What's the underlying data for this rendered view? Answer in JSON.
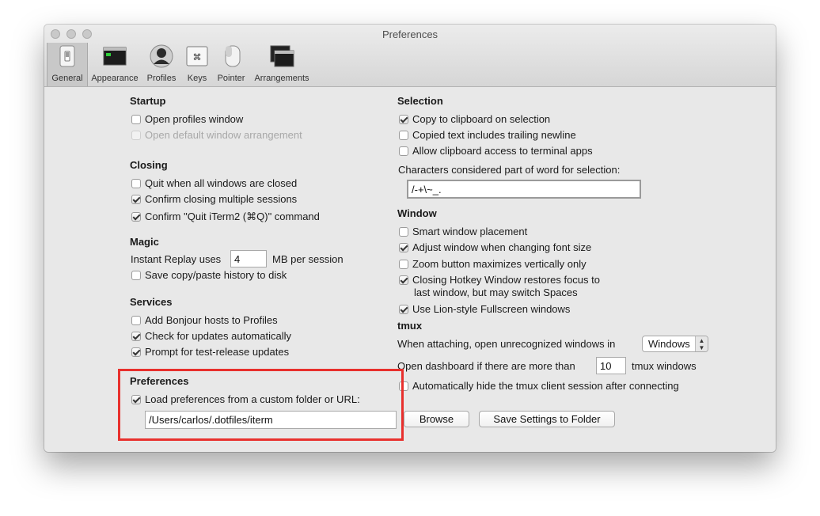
{
  "window": {
    "title": "Preferences"
  },
  "toolbar": {
    "tabs": [
      {
        "label": "General",
        "icon": "switch-icon"
      },
      {
        "label": "Appearance",
        "icon": "monitor-icon"
      },
      {
        "label": "Profiles",
        "icon": "user-icon"
      },
      {
        "label": "Keys",
        "icon": "command-key-icon"
      },
      {
        "label": "Pointer",
        "icon": "mouse-icon"
      },
      {
        "label": "Arrangements",
        "icon": "windows-stack-icon"
      }
    ]
  },
  "startup": {
    "heading": "Startup",
    "open_profiles": "Open profiles window",
    "open_default_arrangement": "Open default window arrangement"
  },
  "closing": {
    "heading": "Closing",
    "quit_when_closed": "Quit when all windows are closed",
    "confirm_multiple": "Confirm closing multiple sessions",
    "confirm_quit": "Confirm \"Quit iTerm2 (⌘Q)\" command"
  },
  "magic": {
    "heading": "Magic",
    "instant_replay_label": "Instant Replay uses",
    "instant_replay_value": "4",
    "instant_replay_unit": "MB per session",
    "save_history": "Save copy/paste history to disk"
  },
  "services": {
    "heading": "Services",
    "bonjour": "Add Bonjour hosts to Profiles",
    "check_updates": "Check for updates automatically",
    "prompt_test_release": "Prompt for test-release updates"
  },
  "preferences": {
    "heading": "Preferences",
    "load_custom": "Load preferences from a custom folder or URL:",
    "path_value": "/Users/carlos/.dotfiles/iterm",
    "browse_label": "Browse",
    "save_settings_label": "Save Settings to Folder"
  },
  "selection": {
    "heading": "Selection",
    "copy_on_selection": "Copy to clipboard on selection",
    "trailing_newline": "Copied text includes trailing newline",
    "clipboard_access": "Allow clipboard access to terminal apps",
    "word_chars_label": "Characters considered part of word for selection:",
    "word_chars_value": "/-+\\~_."
  },
  "window_section": {
    "heading": "Window",
    "smart_placement": "Smart window placement",
    "adjust_font": "Adjust window when changing font size",
    "zoom_vertical": "Zoom button maximizes vertically only",
    "hotkey_restore_line1": "Closing Hotkey Window restores focus to",
    "hotkey_restore_line2": "last window, but may switch Spaces",
    "lion_fullscreen": "Use Lion-style Fullscreen windows"
  },
  "tmux": {
    "heading": "tmux",
    "attach_label": "When attaching, open unrecognized windows in",
    "attach_option": "Windows",
    "dashboard_label": "Open dashboard if there are more than",
    "dashboard_value": "10",
    "dashboard_unit": "tmux windows",
    "autohide": "Automatically hide the tmux client session after connecting"
  },
  "colors": {
    "highlight": "#e8302d"
  }
}
